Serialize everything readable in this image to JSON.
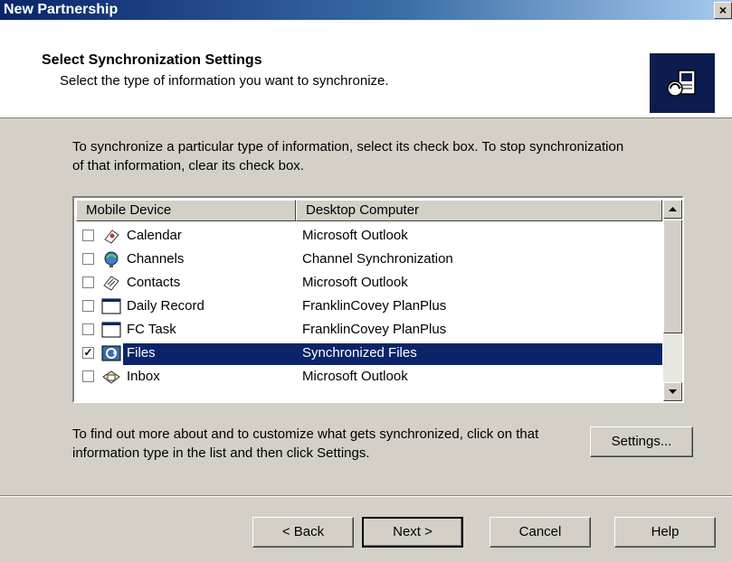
{
  "window": {
    "title": "New Partnership",
    "close_label": "×"
  },
  "header": {
    "title": "Select Synchronization Settings",
    "subtitle": "Select the type of information you want to synchronize.",
    "icon": "sync-pda-computer-icon"
  },
  "intro_text": "To synchronize a particular type of information, select its check box. To stop synchronization of that information, clear its check box.",
  "list": {
    "columns": [
      "Mobile Device",
      "Desktop Computer"
    ],
    "rows": [
      {
        "name": "Calendar",
        "desktop": "Microsoft Outlook",
        "checked": false,
        "selected": false,
        "icon": "calendar-icon"
      },
      {
        "name": "Channels",
        "desktop": "Channel Synchronization",
        "checked": false,
        "selected": false,
        "icon": "channels-icon"
      },
      {
        "name": "Contacts",
        "desktop": "Microsoft Outlook",
        "checked": false,
        "selected": false,
        "icon": "contacts-icon"
      },
      {
        "name": "Daily Record",
        "desktop": "FranklinCovey PlanPlus",
        "checked": false,
        "selected": false,
        "icon": "window-icon"
      },
      {
        "name": "FC Task",
        "desktop": "FranklinCovey PlanPlus",
        "checked": false,
        "selected": false,
        "icon": "window-icon"
      },
      {
        "name": "Files",
        "desktop": "Synchronized Files",
        "checked": true,
        "selected": true,
        "icon": "files-sync-icon"
      },
      {
        "name": "Inbox",
        "desktop": "Microsoft Outlook",
        "checked": false,
        "selected": false,
        "icon": "inbox-icon"
      }
    ],
    "check_mark": "✓"
  },
  "help_text": "To find out more about and to customize what gets synchronized, click on that information type in the list and then click Settings.",
  "buttons": {
    "settings": "Settings...",
    "back": "< Back",
    "next": "Next >",
    "cancel": "Cancel",
    "help": "Help"
  },
  "colors": {
    "selection": "#0a246a",
    "face": "#d4d0c8"
  }
}
